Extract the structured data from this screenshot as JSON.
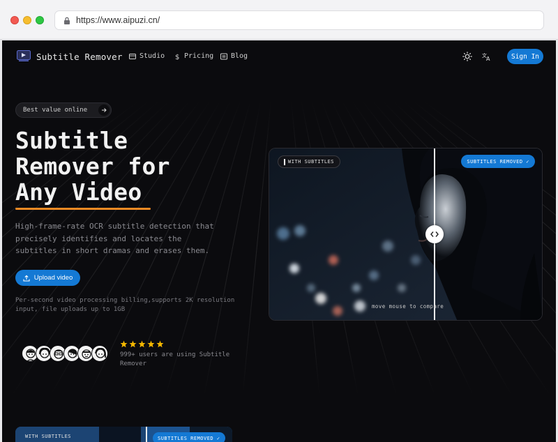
{
  "browser": {
    "url": "https://www.aipuzi.cn/"
  },
  "nav": {
    "brand": "Subtitle Remover",
    "links": [
      {
        "label": "Studio",
        "icon": "studio-icon"
      },
      {
        "label": "Pricing",
        "icon": "dollar-icon"
      },
      {
        "label": "Blog",
        "icon": "blog-icon"
      }
    ],
    "theme_icon": "sun-icon",
    "language_icon": "translate-icon",
    "signin_label": "Sign In"
  },
  "hero": {
    "badge": "Best value online",
    "title_line1": "Subtitle",
    "title_line2": "Remover for",
    "title_line3": "Any Video",
    "description": "High-frame-rate OCR subtitle detection that precisely identifies and locates the subtitles in short dramas and erases them.",
    "upload_label": "Upload video",
    "note": "Per-second video processing billing,supports 2K resolution input, file uploads up to 1GB",
    "rating_stars": 5,
    "users_text": "999+ users are using Subtitle Remover"
  },
  "compare": {
    "left_tag": "WITH SUBTITLES",
    "right_tag": "SUBTITLES REMOVED ✓",
    "hint": "move mouse to compare"
  },
  "preview": {
    "left_tag": "WITH SUBTITLES",
    "right_tag": "SUBTITLES REMOVED ✓"
  },
  "colors": {
    "accent": "#1479d4",
    "underline": "#f08a24",
    "background": "#0b0b0e",
    "star": "#f5b800"
  }
}
